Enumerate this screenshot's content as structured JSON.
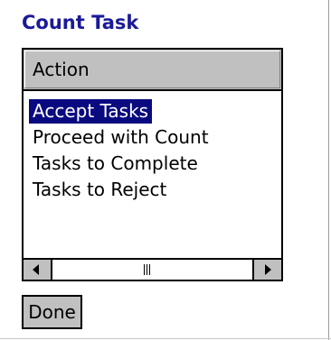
{
  "page": {
    "title": "Count Task"
  },
  "listview": {
    "column_header": "Action",
    "items": [
      {
        "label": "Accept Tasks",
        "selected": true
      },
      {
        "label": "Proceed with Count",
        "selected": false
      },
      {
        "label": "Tasks to Complete",
        "selected": false
      },
      {
        "label": "Tasks to Reject",
        "selected": false
      }
    ],
    "scrollbar": {
      "left_arrow_icon": "triangle-left-icon",
      "right_arrow_icon": "triangle-right-icon",
      "grip_icon": "scroll-grip-icon"
    }
  },
  "actions": {
    "done_label": "Done"
  },
  "colors": {
    "title": "#1a1a99",
    "selection_bg": "#0a0a80",
    "selection_text": "#ffffff",
    "control_face": "#c0c0c0"
  }
}
